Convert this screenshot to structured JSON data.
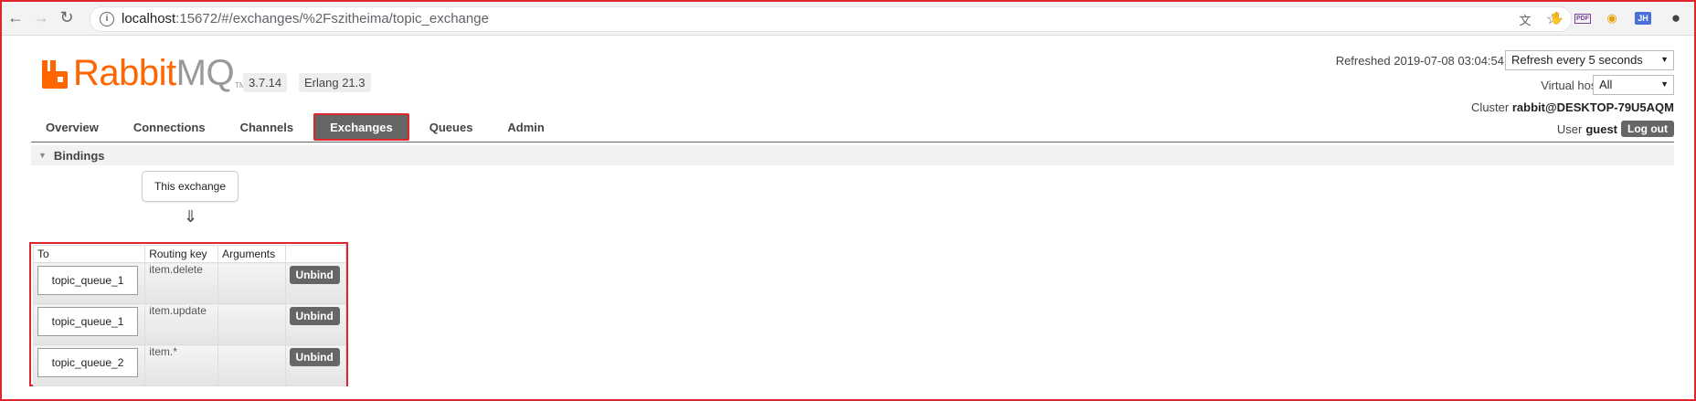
{
  "browser": {
    "url_host": "localhost",
    "url_path": ":15672/#/exchanges/%2Fszitheima/topic_exchange",
    "ext_pdf": "PDF",
    "ext_user": "JH"
  },
  "header": {
    "logo_main": "Rabbit",
    "logo_mq": "MQ",
    "logo_tm": "TM",
    "rabbitmq_version": "3.7.14",
    "erlang_version": "Erlang 21.3",
    "refreshed_label": "Refreshed 2019-07-08 03:04:54",
    "refresh_select": "Refresh every 5 seconds",
    "vhost_label": "Virtual host",
    "vhost_select": "All",
    "cluster_label": "Cluster",
    "cluster_name": "rabbit@DESKTOP-79U5AQM",
    "user_label": "User",
    "user_name": "guest",
    "logout_label": "Log out"
  },
  "tabs": [
    {
      "label": "Overview"
    },
    {
      "label": "Connections"
    },
    {
      "label": "Channels"
    },
    {
      "label": "Exchanges"
    },
    {
      "label": "Queues"
    },
    {
      "label": "Admin"
    }
  ],
  "bindings": {
    "title": "Bindings",
    "this_exchange": "This exchange",
    "arrow": "⇓",
    "columns": [
      "To",
      "Routing key",
      "Arguments"
    ],
    "rows": [
      {
        "to": "topic_queue_1",
        "routing_key": "item.delete",
        "arguments": "",
        "action": "Unbind"
      },
      {
        "to": "topic_queue_1",
        "routing_key": "item.update",
        "arguments": "",
        "action": "Unbind"
      },
      {
        "to": "topic_queue_2",
        "routing_key": "item.*",
        "arguments": "",
        "action": "Unbind"
      }
    ]
  },
  "colors": {
    "brand_orange": "#ff6600",
    "highlight_red": "#e0262c",
    "tab_active": "#666666"
  }
}
